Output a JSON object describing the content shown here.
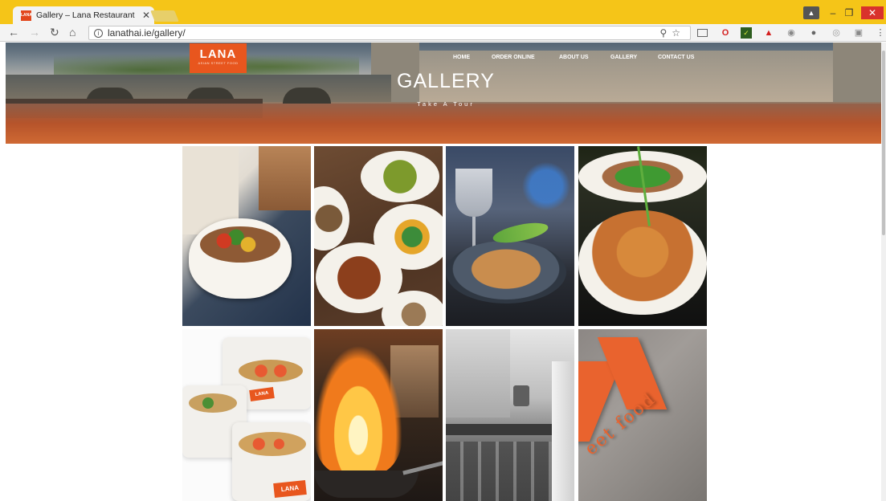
{
  "browser": {
    "tab_title": "Gallery – Lana Restaurant",
    "tab_favicon_text": "LANA",
    "url": "lanathai.ie/gallery/"
  },
  "site": {
    "logo_text": "LANA",
    "logo_subtitle": "ASIAN STREET FOOD",
    "nav": [
      "HOME",
      "ORDER ONLINE",
      "ABOUT US",
      "GALLERY",
      "CONTACT US"
    ],
    "hero_title": "GALLERY",
    "hero_subtitle": "Take A Tour"
  },
  "gallery": {
    "tiles": [
      {
        "name": "noodle-bowl",
        "branded": false
      },
      {
        "name": "shared-plates",
        "branded": false
      },
      {
        "name": "pad-thai-wine",
        "branded": false
      },
      {
        "name": "noodle-plate",
        "branded": false
      },
      {
        "name": "takeaway-boxes",
        "branded": true,
        "brand_text": "LANA"
      },
      {
        "name": "wok-flames",
        "branded": false
      },
      {
        "name": "kitchen-chef",
        "branded": false
      },
      {
        "name": "logo-wall",
        "branded": true,
        "brand_text": "eet food"
      }
    ]
  },
  "colors": {
    "accent": "#e8561e",
    "browser_frame": "#f5c518"
  }
}
